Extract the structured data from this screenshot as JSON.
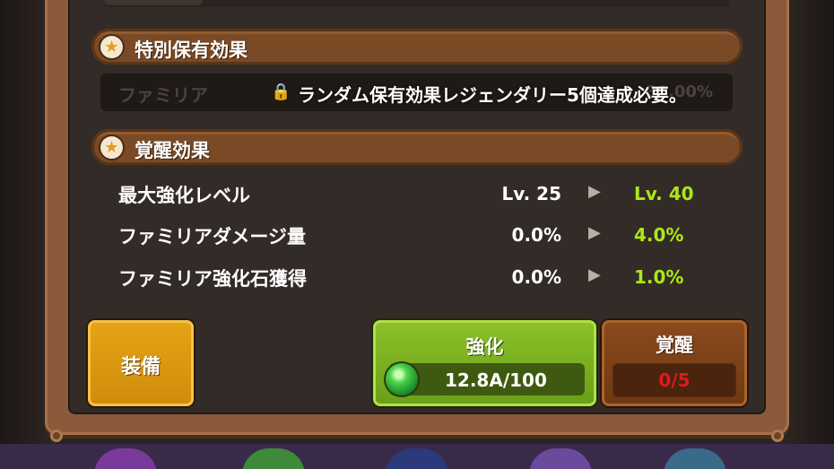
{
  "top_strip": {
    "hidden_text": ""
  },
  "special_effect": {
    "title": "特別保有効果",
    "locked_message": "ランダム保有効果レジェンダリー5個達成必要。",
    "faded_left": "ファミリア",
    "faded_right": "30.00%"
  },
  "awaken_effect": {
    "title": "覚醒効果",
    "stats": [
      {
        "label": "最大強化レベル",
        "current": "Lv. 25",
        "next": "Lv. 40"
      },
      {
        "label": "ファミリアダメージ量",
        "current": "0.0%",
        "next": "4.0%"
      },
      {
        "label": "ファミリア強化石獲得",
        "current": "0.0%",
        "next": "1.0%"
      }
    ]
  },
  "buttons": {
    "equip_label": "装備",
    "enhance_label": "強化",
    "enhance_cost": "12.8A/100",
    "awaken_label": "覚醒",
    "awaken_count": "0/5"
  },
  "icons": {
    "star": "star-icon",
    "lock": "lock-icon",
    "arrow": "play-arrow-icon",
    "gem": "green-gem-icon"
  },
  "colors": {
    "next_value": "#aee619",
    "awaken_count": "#e01a1a",
    "enhance_button": "#7ab020",
    "equip_button": "#e0a016"
  }
}
